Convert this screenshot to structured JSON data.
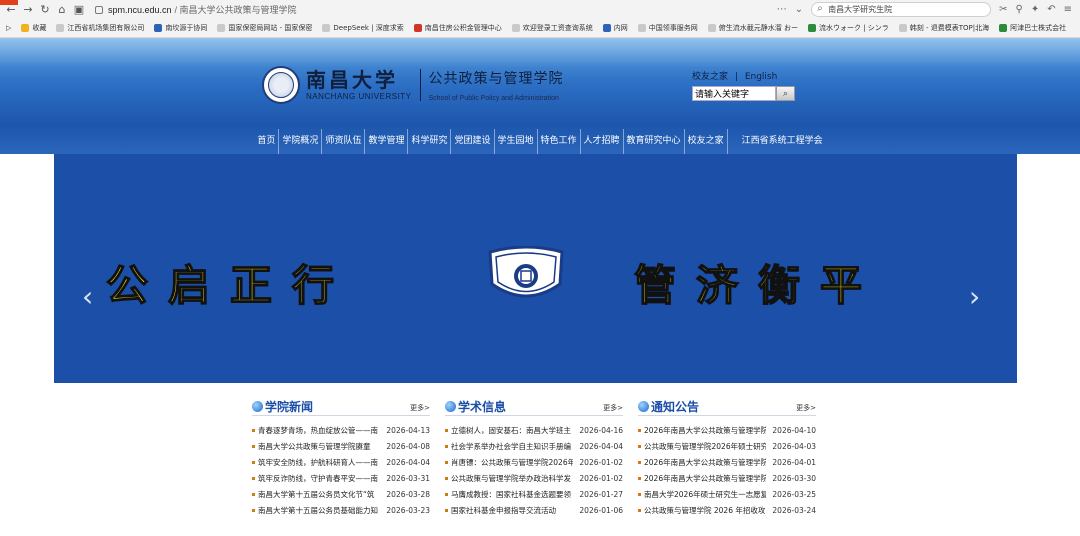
{
  "browser": {
    "url_host": "spm.ncu.edu.cn",
    "url_rest": "/ 南昌大学公共政策与管理学院",
    "search_text": "南昌大学研究生院",
    "bookmarks": [
      "收藏",
      "江西省机场集团有限公司",
      "南坎源于协同",
      "国家保密局网站 - 国家保密",
      "DeepSeek | 深度求索",
      "南昌住房公积金管理中心",
      "欢迎登录工资查询系统",
      "内网",
      "中国领事服务网",
      "俯生流水截元静水溜 おー",
      "流水ウォーク | シンラ",
      "韩刻 - 退费模表TOP|北海",
      "阿津巴士株式会社"
    ]
  },
  "header": {
    "university_cn": "南昌大学",
    "university_en": "NANCHANG UNIVERSITY",
    "school_cn": "公共政策与管理学院",
    "school_en": "School of Public Policy and Administration",
    "link_alumni": "校友之家",
    "link_separator": "|",
    "link_english": "English",
    "search_placeholder": "请输入关键字"
  },
  "nav": {
    "items": [
      "首页",
      "学院概况",
      "师资队伍",
      "教学管理",
      "科学研究",
      "党团建设",
      "学生园地",
      "特色工作",
      "人才招聘",
      "教育研究中心",
      "校友之家",
      "江西省系统工程学会"
    ]
  },
  "banner": {
    "slogan_left": "公启正行",
    "slogan_right": "管济衡平"
  },
  "columns": [
    {
      "title": "学院新闻",
      "more": "更多>",
      "items": [
        {
          "title": "青春逐梦青场，热血绽放公管——南",
          "date": "2026-04-13"
        },
        {
          "title": "南昌大学公共政策与管理学院赓童",
          "date": "2026-04-08"
        },
        {
          "title": "筑牢安全防线，护航科研育人——南",
          "date": "2026-04-04"
        },
        {
          "title": "筑牢反诈防线，守护青春平安——南",
          "date": "2026-03-31"
        },
        {
          "title": "南昌大学第十五届公务员文化节“筑",
          "date": "2026-03-28"
        },
        {
          "title": "南昌大学第十五届公务员基础能力知",
          "date": "2026-03-23"
        }
      ]
    },
    {
      "title": "学术信息",
      "more": "更多>",
      "items": [
        {
          "title": "立德树人，固安基石：南昌大学班主",
          "date": "2026-04-16"
        },
        {
          "title": "社会学系举办社会学自主知识手册编",
          "date": "2026-04-04"
        },
        {
          "title": "肖唐镖：公共政策与管理学院2026年",
          "date": "2026-01-02"
        },
        {
          "title": "公共政策与管理学院举办政治科学发",
          "date": "2026-01-02"
        },
        {
          "title": "马膺成教授：国家社科基金选题要领",
          "date": "2026-01-27"
        },
        {
          "title": "国家社科基金申报指导交流活动",
          "date": "2026-01-06"
        }
      ]
    },
    {
      "title": "通知公告",
      "more": "更多>",
      "items": [
        {
          "title": "2026年南昌大学公共政策与管理学院",
          "date": "2026-04-10"
        },
        {
          "title": "公共政策与管理学院2026年硕士研究",
          "date": "2026-04-03"
        },
        {
          "title": "2026年南昌大学公共政策与管理学院",
          "date": "2026-04-01"
        },
        {
          "title": "2026年南昌大学公共政策与管理学院",
          "date": "2026-03-30"
        },
        {
          "title": "南昌大学2026年硕士研究生一志愿复",
          "date": "2026-03-25"
        },
        {
          "title": "公共政策与管理学院 2026 年招收攻",
          "date": "2026-03-24"
        }
      ]
    }
  ]
}
